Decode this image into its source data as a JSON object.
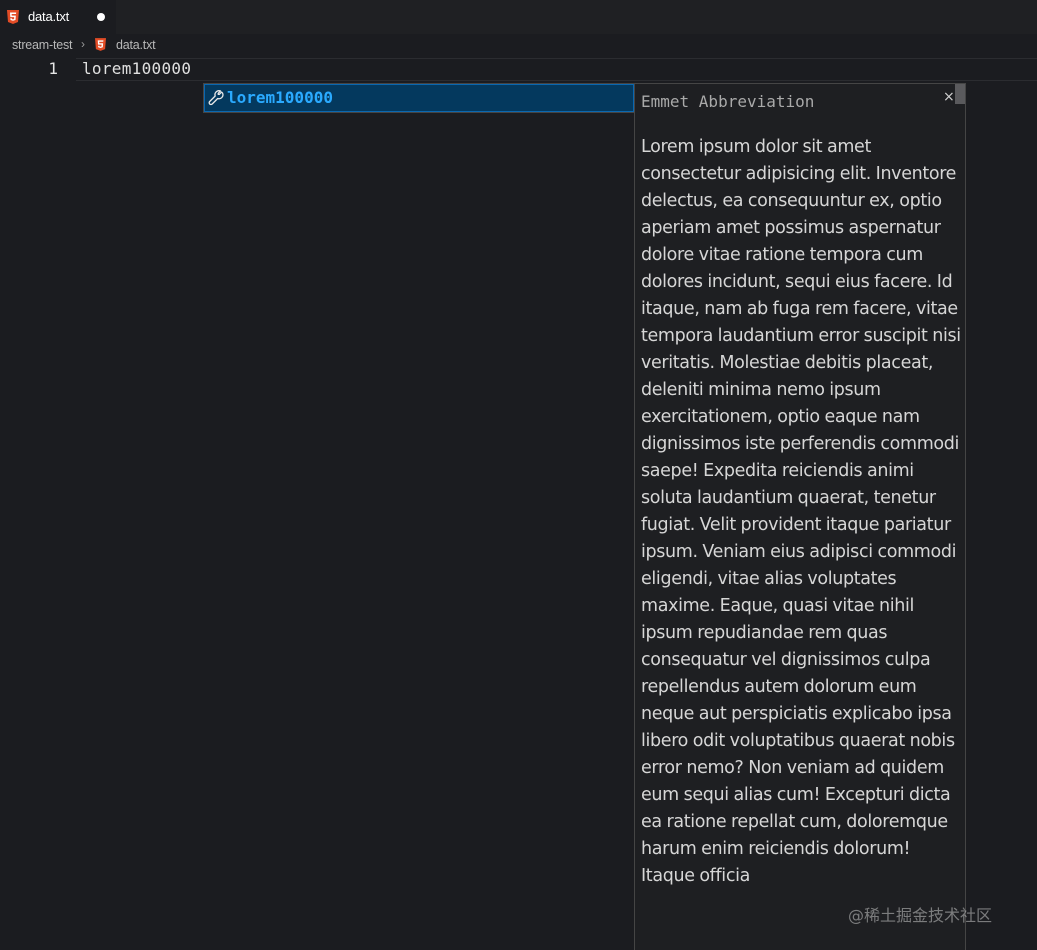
{
  "tab": {
    "label": "data.txt",
    "icon": "html5-icon",
    "dirty": true
  },
  "breadcrumb": {
    "folder": "stream-test",
    "separator": "›",
    "file": "data.txt"
  },
  "editor": {
    "line_number": "1",
    "line_text": "lorem100000"
  },
  "suggest": {
    "label": "lorem100000",
    "icon": "wrench-icon"
  },
  "details": {
    "title": "Emmet Abbreviation",
    "close": "×",
    "body": "Lorem ipsum dolor sit amet consectetur adipisicing elit. Inventore delectus, ea consequuntur ex, optio aperiam amet possimus aspernatur dolore vitae ratione tempora cum dolores incidunt, sequi eius facere. Id itaque, nam ab fuga rem facere, vitae tempora laudantium error suscipit nisi veritatis. Molestiae debitis placeat, deleniti minima nemo ipsum exercitationem, optio eaque nam dignissimos iste perferendis commodi saepe! Expedita reiciendis animi soluta laudantium quaerat, tenetur fugiat. Velit provident itaque pariatur ipsum. Veniam eius adipisci commodi eligendi, vitae alias voluptates maxime. Eaque, quasi vitae nihil ipsum repudiandae rem quas consequatur vel dignissimos culpa repellendus autem dolorum eum neque aut perspiciatis explicabo ipsa libero odit voluptatibus quaerat nobis error nemo? Non veniam ad quidem eum sequi alias cum! Excepturi dicta ea ratione repellat cum, doloremque harum enim reiciendis dolorum! Itaque officia"
  },
  "watermark": "@稀土掘金技术社区",
  "colors": {
    "html_icon": "#e34c26",
    "selection": "#04395e",
    "suggest_text": "#2aaaff"
  }
}
